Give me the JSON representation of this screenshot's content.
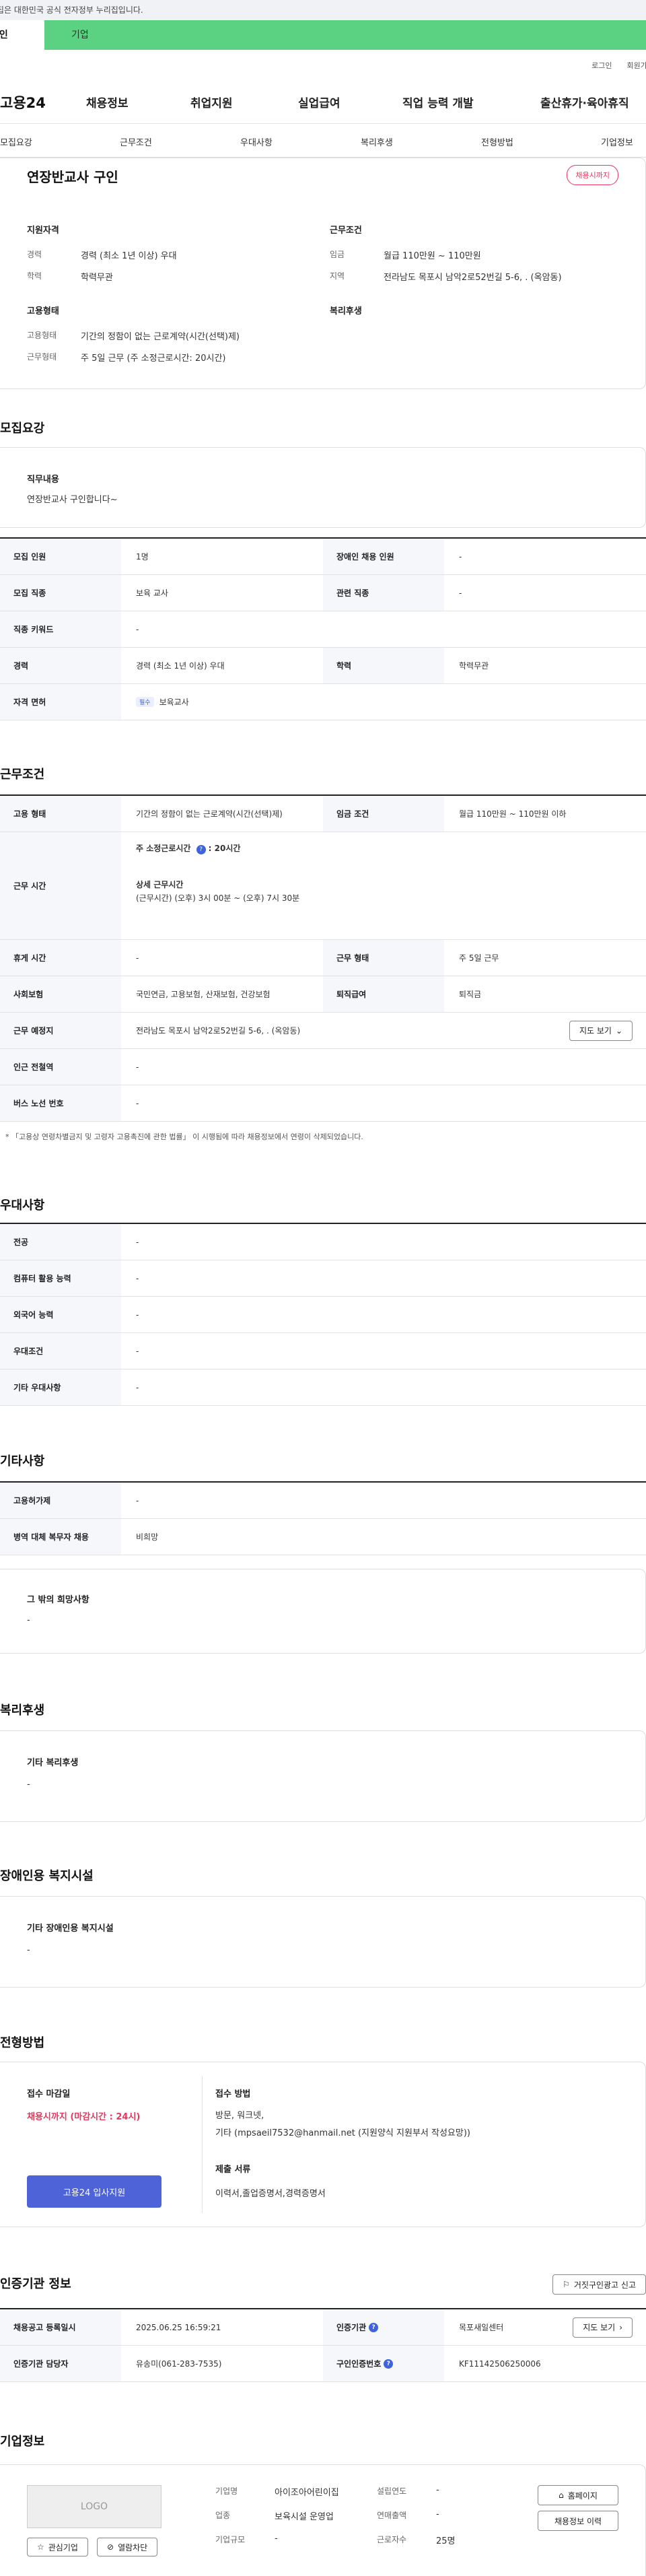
{
  "gov_banner": "이 누리집은 대한민국 공식 전자정부 누리집입니다.",
  "tabs": {
    "personal": "개인",
    "company": "기업"
  },
  "util": {
    "login": "로그인",
    "join": "회원가입"
  },
  "gnb": {
    "logo": "고용24",
    "menu": [
      "채용정보",
      "취업지원",
      "실업급여",
      "직업 능력 개발",
      "출산휴가·육아휴직"
    ]
  },
  "anchors": [
    "모집요강",
    "근무조건",
    "우대사항",
    "복리후생",
    "전형방법",
    "기업정보"
  ],
  "summary": {
    "title": "연장반교사 구인",
    "status": "채용시까지",
    "qual_h": "지원자격",
    "qual": [
      {
        "k": "경력",
        "v": "경력 (최소 1년 이상) 우대"
      },
      {
        "k": "학력",
        "v": "학력무관"
      }
    ],
    "cond_h": "근무조건",
    "cond": [
      {
        "k": "임금",
        "v": "월급 110만원 ~ 110만원"
      },
      {
        "k": "지역",
        "v": "전라남도 목포시 남악2로52번길 5-6, . (옥암동)"
      }
    ],
    "emp_h": "고용형태",
    "emp": [
      {
        "k": "고용형태",
        "v": "기간의 정함이 없는 근로계약(시간(선택)제)"
      },
      {
        "k": "근무형태",
        "v": "주 5일 근무 (주 소정근로시간: 20시간)"
      }
    ],
    "welfare_h": "복리후생"
  },
  "recruit": {
    "h": "모집요강",
    "duty_h": "직무내용",
    "duty": "연장반교사 구인합니다~",
    "rows": [
      [
        "모집 인원",
        "1명",
        "장애인 채용 인원",
        "-"
      ],
      [
        "모집 직종",
        "보육 교사",
        "관련 직종",
        "-"
      ]
    ],
    "keyword": [
      "직종 키워드",
      "-"
    ],
    "rows2": [
      [
        "경력",
        "경력 (최소 1년 이상) 우대",
        "학력",
        "학력무관"
      ]
    ],
    "license": {
      "k": "자격 면허",
      "chip": "필수",
      "v": "보육교사"
    }
  },
  "work": {
    "h": "근무조건",
    "r1": [
      "고용 형태",
      "기간의 정함이 없는 근로계약(시간(선택)제)",
      "임금 조건",
      "월급 110만원 ~ 110만원 이하"
    ],
    "hours_k": "근무 시간",
    "hours_weekly": "주 소정근로시간 ",
    "hours_weekly_val": ": 20시간",
    "hours_detail_h": "상세 근무시간",
    "hours_detail": "(근무시간) (오후) 3시 00분 ~ (오후) 7시 30분",
    "r2": [
      "휴게 시간",
      "-",
      "근무 형태",
      "주 5일 근무"
    ],
    "r3": [
      "사회보험",
      "국민연금, 고용보험, 산재보험, 건강보험",
      "퇴직급여",
      "퇴직금"
    ],
    "place": [
      "근무 예정지",
      "전라남도 목포시 남악2로52번길 5-6, . (옥암동)"
    ],
    "map_btn": "지도 보기",
    "r4": [
      "인근 전철역",
      "-"
    ],
    "r5": [
      "버스 노선 번호",
      "-"
    ],
    "note": "* 「고용상 연령차별금지 및 고령자 고용촉진에 관한 법률」 이 시행됨에 따라 채용정보에서 연령이 삭제되었습니다."
  },
  "pref": {
    "h": "우대사항",
    "rows": [
      [
        "전공",
        "-"
      ],
      [
        "컴퓨터 활용 능력",
        "-"
      ],
      [
        "외국어 능력",
        "-"
      ],
      [
        "우대조건",
        "-"
      ],
      [
        "기타 우대사항",
        "-"
      ]
    ]
  },
  "etc": {
    "h": "기타사항",
    "rows": [
      [
        "고용허가제",
        "-"
      ],
      [
        "병역 대체 복무자 채용",
        "비희망"
      ]
    ],
    "box_h": "그 밖의 희망사항",
    "box_v": "-"
  },
  "welfare": {
    "h": "복리후생",
    "box_h": "기타 복리후생",
    "box_v": "-"
  },
  "disabled": {
    "h": "장애인용 복지시설",
    "box_h": "기타 장애인용 복지시설",
    "box_v": "-"
  },
  "process": {
    "h": "전형방법",
    "deadline_h": "접수 마감일",
    "deadline": "채용시까지 (마감시간 : 24시)",
    "apply_btn": "고용24 입사지원",
    "method_h": "접수 방법",
    "method1": "방문, 워크넷,",
    "method2": "기타 (mpsaeil7532@hanmail.net (지원양식 지원부서 작성요망))",
    "docs_h": "제출 서류",
    "docs": "이력서,졸업증명서,경력증명서"
  },
  "auth": {
    "h": "인증기관 정보",
    "report_btn": "거짓구인광고 신고",
    "r1": [
      "채용공고 등록일시",
      "2025.06.25 16:59:21",
      "인증기관",
      "목포새일센터"
    ],
    "r2": [
      "인증기관 담당자",
      "유송미(061-283-7535)",
      "구인인증번호",
      "KF11142506250006"
    ],
    "map_btn": "지도 보기"
  },
  "company": {
    "h": "기업정보",
    "logo": "LOGO",
    "fav_btn": "관심기업",
    "block_btn": "열람차단",
    "f": [
      [
        "기업명",
        "아이조아어린이집",
        "설립연도",
        "-"
      ],
      [
        "업종",
        "보육시설 운영업",
        "연매출액",
        "-"
      ],
      [
        "기업규모",
        "-",
        "근로자수",
        "25명"
      ]
    ],
    "home_btn": "홈페이지",
    "hist_btn": "채용정보 이력"
  }
}
